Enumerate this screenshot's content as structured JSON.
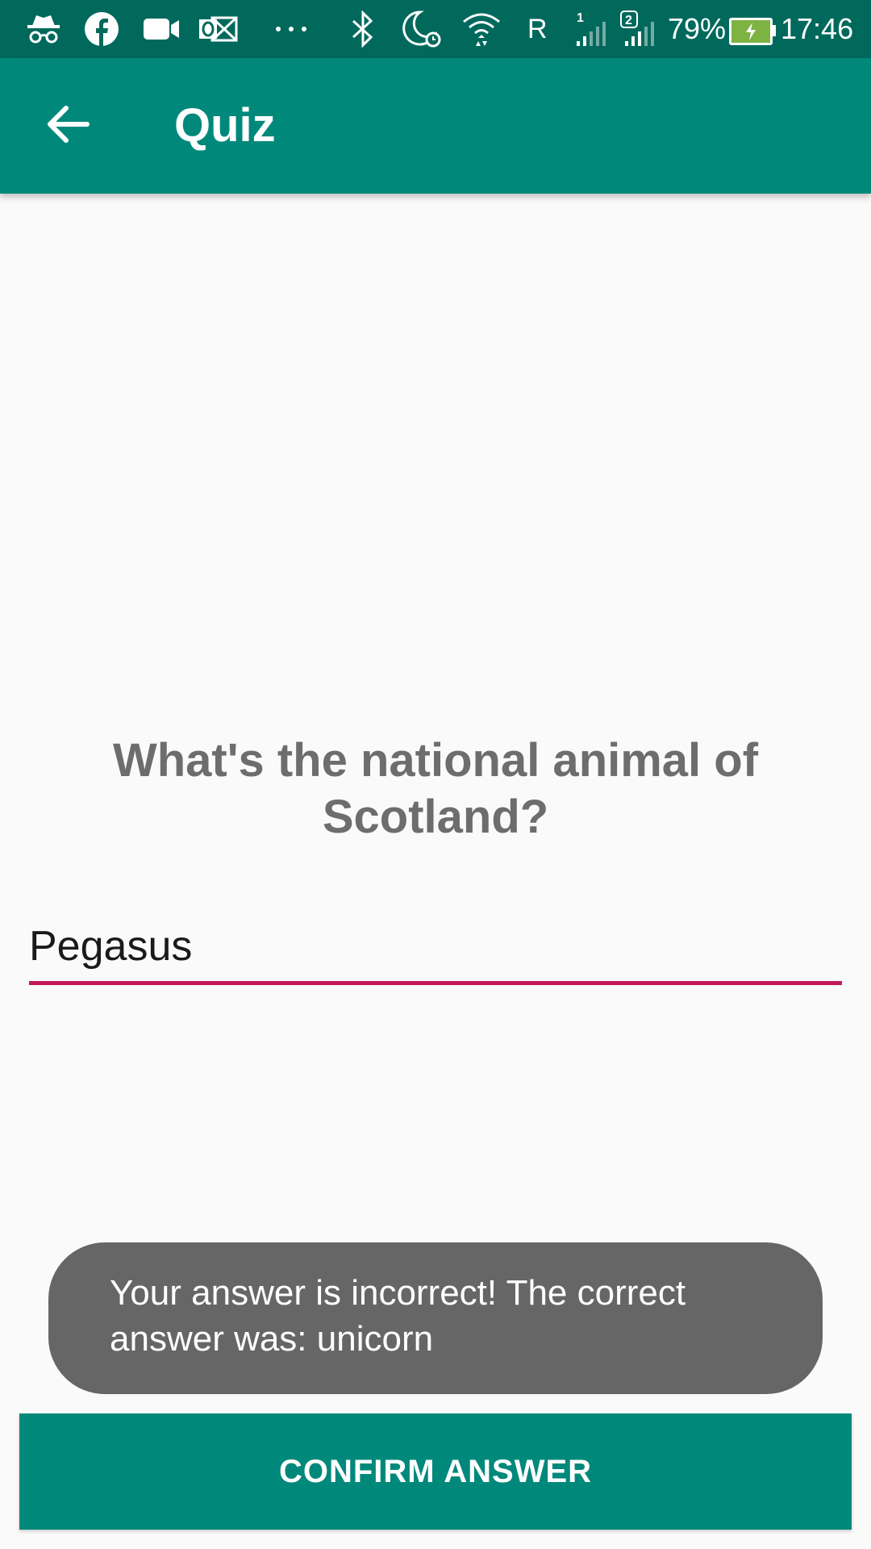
{
  "status_bar": {
    "icons": [
      "incognito-icon",
      "facebook-icon",
      "video-camera-icon",
      "outlook-icon",
      "more-dots-icon",
      "bluetooth-icon",
      "do-not-disturb-alarm-icon",
      "wifi-icon"
    ],
    "roaming": "R",
    "sim1_label": "1",
    "sim2_label": "2",
    "battery": "79%",
    "time": "17:46",
    "colors": {
      "background": "#00695c",
      "battery_fill": "#7cb342"
    }
  },
  "app_bar": {
    "title": "Quiz",
    "back_icon": "arrow-back-icon",
    "color": "#00897b"
  },
  "quiz": {
    "question": "What's the national animal of Scotland?",
    "answer_value": "Pegasus",
    "underline_color": "#c2185b"
  },
  "toast": {
    "message": "Your answer is incorrect! The correct answer was: unicorn"
  },
  "actions": {
    "confirm_label": "CONFIRM ANSWER"
  }
}
